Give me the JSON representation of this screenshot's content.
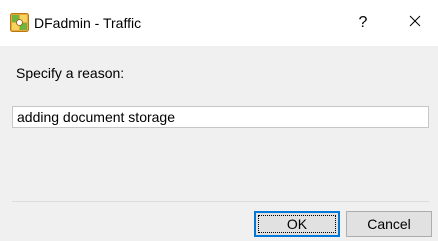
{
  "window": {
    "title": "DFadmin - Traffic",
    "help_glyph": "?",
    "icons": {
      "app": "dfadmin-app-icon",
      "help": "help-icon",
      "close": "close-icon"
    }
  },
  "dialog": {
    "prompt": "Specify a reason:",
    "reason_value": "adding document storage"
  },
  "buttons": {
    "ok_label": "OK",
    "cancel_label": "Cancel"
  },
  "colors": {
    "titlebar": "#ffffff",
    "body": "#f0f0f0",
    "focus_border": "#0078d7",
    "button_face": "#e1e1e1"
  }
}
